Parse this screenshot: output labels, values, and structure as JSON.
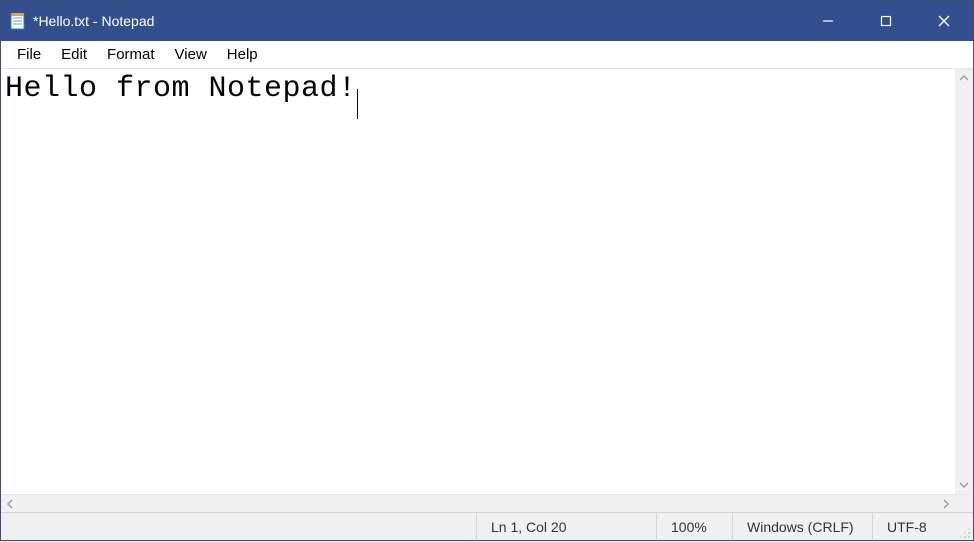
{
  "window": {
    "title": "*Hello.txt - Notepad"
  },
  "menu": {
    "items": [
      "File",
      "Edit",
      "Format",
      "View",
      "Help"
    ]
  },
  "editor": {
    "content": "Hello from Notepad!"
  },
  "statusbar": {
    "position": "Ln 1, Col 20",
    "zoom": "100%",
    "line_ending": "Windows (CRLF)",
    "encoding": "UTF-8"
  }
}
